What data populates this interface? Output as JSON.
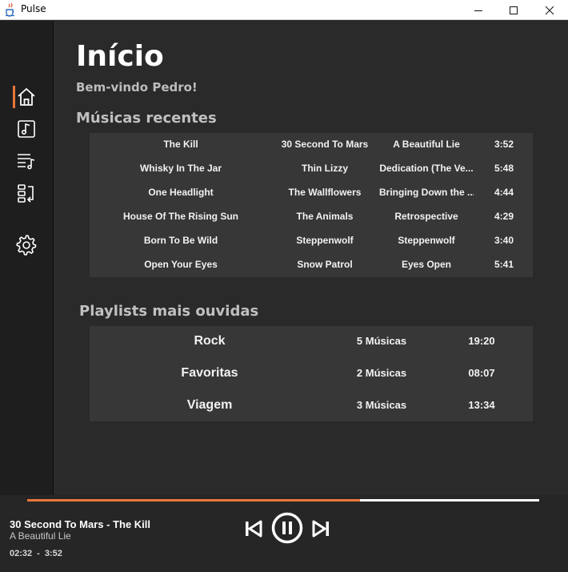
{
  "window": {
    "title": "Pulse",
    "icons": {
      "app": "java-cup-icon",
      "minimize": "minimize-icon",
      "maximize": "maximize-icon",
      "close": "close-icon"
    }
  },
  "sidebar": {
    "items": [
      {
        "id": "home",
        "icon": "home-icon",
        "active": true
      },
      {
        "id": "music",
        "icon": "music-note-icon",
        "active": false
      },
      {
        "id": "playlist",
        "icon": "playlist-icon",
        "active": false
      },
      {
        "id": "queue",
        "icon": "queue-icon",
        "active": false
      },
      {
        "id": "settings",
        "icon": "gear-icon",
        "active": false
      }
    ]
  },
  "main": {
    "title": "Início",
    "welcome": "Bem-vindo Pedro!",
    "recent": {
      "title": "Músicas recentes",
      "rows": [
        {
          "song": "The Kill",
          "artist": "30 Second To Mars",
          "album": "A Beautiful Lie",
          "duration": "3:52"
        },
        {
          "song": "Whisky In The Jar",
          "artist": "Thin Lizzy",
          "album": "Dedication (The Ve...",
          "duration": "5:48"
        },
        {
          "song": "One Headlight",
          "artist": "The Wallflowers",
          "album": "Bringing Down the ...",
          "duration": "4:44"
        },
        {
          "song": "House Of The Rising Sun",
          "artist": "The Animals",
          "album": "Retrospective",
          "duration": "4:29"
        },
        {
          "song": "Born To Be Wild",
          "artist": "Steppenwolf",
          "album": "Steppenwolf",
          "duration": "3:40"
        },
        {
          "song": "Open Your Eyes",
          "artist": "Snow Patrol",
          "album": "Eyes Open",
          "duration": "5:41"
        }
      ]
    },
    "playlists": {
      "title": "Playlists mais ouvidas",
      "rows": [
        {
          "name": "Rock",
          "count": "5 Músicas",
          "duration": "19:20"
        },
        {
          "name": "Favoritas",
          "count": "2 Músicas",
          "duration": "08:07"
        },
        {
          "name": "Viagem",
          "count": "3 Músicas",
          "duration": "13:34"
        }
      ]
    }
  },
  "player": {
    "now_playing": "30 Second To Mars - The Kill",
    "album": "A Beautiful Lie",
    "elapsed": "02:32",
    "separator": "-",
    "total": "3:52",
    "progress_fraction": 0.65,
    "accent_color": "#e8763a",
    "controls": {
      "prev": "skip-previous-icon",
      "play_pause": "pause-icon",
      "next": "skip-next-icon"
    }
  }
}
